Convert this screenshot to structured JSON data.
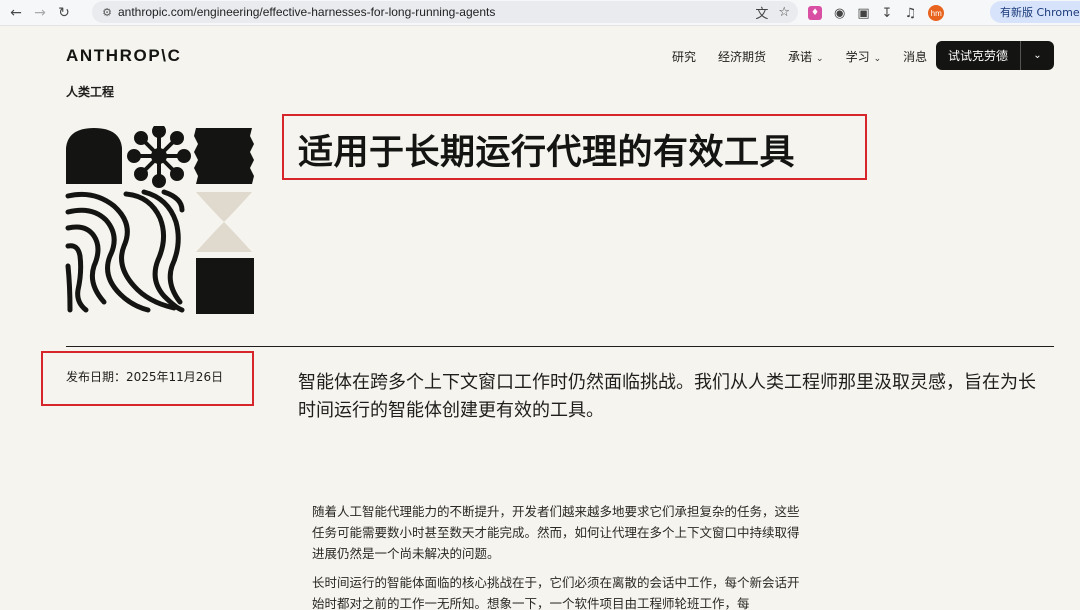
{
  "browser": {
    "url": "anthropic.com/engineering/effective-harnesses-for-long-running-agents",
    "profile_initials": "hm",
    "new_chrome_label": "有新版 Chrome 可",
    "icons": [
      "back-arrow-icon",
      "forward-arrow-icon",
      "reload-icon",
      "site-settings-icon",
      "translate-icon",
      "star-icon",
      "extension-icon",
      "puzzle-icon",
      "download-icon",
      "media-icon"
    ]
  },
  "site": {
    "logo": "ANTHROP\\C",
    "nav": [
      {
        "label": "研究",
        "dropdown": false
      },
      {
        "label": "经济期货",
        "dropdown": false
      },
      {
        "label": "承诺",
        "dropdown": true
      },
      {
        "label": "学习",
        "dropdown": true
      },
      {
        "label": "消息",
        "dropdown": false
      }
    ],
    "cta_label": "试试克劳德"
  },
  "article": {
    "section": "人类工程",
    "title": "适用于长期运行代理的有效工具",
    "date": "发布日期：2025年11月26日",
    "lead": "智能体在跨多个上下文窗口工作时仍然面临挑战。我们从人类工程师那里汲取灵感，旨在为长时间运行的智能体创建更有效的工具。",
    "paragraphs": [
      "随着人工智能代理能力的不断提升，开发者们越来越多地要求它们承担复杂的任务，这些任务可能需要数小时甚至数天才能完成。然而，如何让代理在多个上下文窗口中持续取得进展仍然是一个尚未解决的问题。",
      "长时间运行的智能体面临的核心挑战在于，它们必须在离散的会话中工作，每个新会话开始时都对之前的工作一无所知。想象一下，一个软件项目由工程师轮班工作，每"
    ]
  },
  "colors": {
    "page_bg": "#f5f4ee",
    "ink": "#141413",
    "highlight_red": "#d6262b",
    "illustration_beige": "#e0d9cd"
  }
}
